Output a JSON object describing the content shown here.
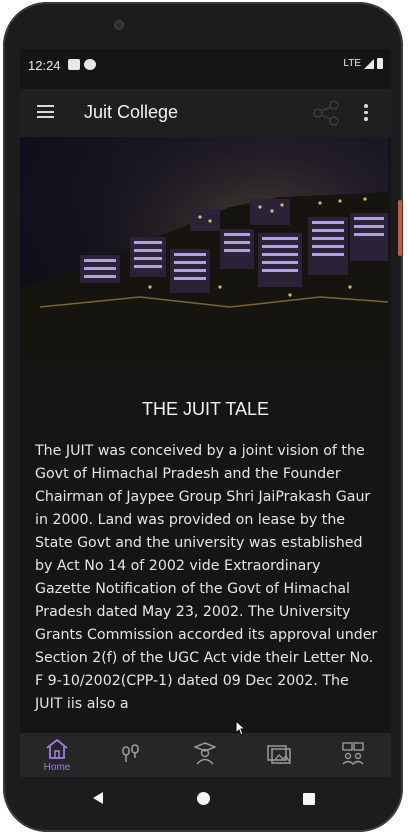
{
  "status": {
    "time": "12:24",
    "network": "LTE"
  },
  "appbar": {
    "title": "Juit College",
    "menu_icon": "menu-icon",
    "share_icon": "share-icon",
    "more_icon": "more-vert-icon"
  },
  "banner": {
    "slides": 2,
    "active_slide": 2
  },
  "content": {
    "heading": "THE JUIT TALE",
    "paragraph": "The JUIT was conceived by a joint vision of the Govt of Himachal Pradesh and the Founder Chairman of Jaypee Group Shri JaiPrakash Gaur in 2000. Land was provided on lease by the State Govt and the university was established by Act No 14 of 2002 vide Extraordinary Gazette Notification of the Govt of Himachal Pradesh dated May 23, 2002. The University Grants Commission accorded its approval under Section 2(f) of the UGC Act vide their Letter No. F 9-10/2002(CPP-1) dated 09 Dec 2002. The JUIT iis also a"
  },
  "bottom_nav": {
    "items": [
      {
        "label": "Home",
        "icon": "home-icon",
        "active": true
      },
      {
        "label": "",
        "icon": "microphone-icon",
        "active": false
      },
      {
        "label": "",
        "icon": "graduate-icon",
        "active": false
      },
      {
        "label": "",
        "icon": "gallery-icon",
        "active": false
      },
      {
        "label": "",
        "icon": "contacts-icon",
        "active": false
      }
    ]
  },
  "colors": {
    "accent": "#a07ae0",
    "background": "#151515",
    "appbar": "#1f1f1f",
    "bottom_nav": "#262626"
  }
}
